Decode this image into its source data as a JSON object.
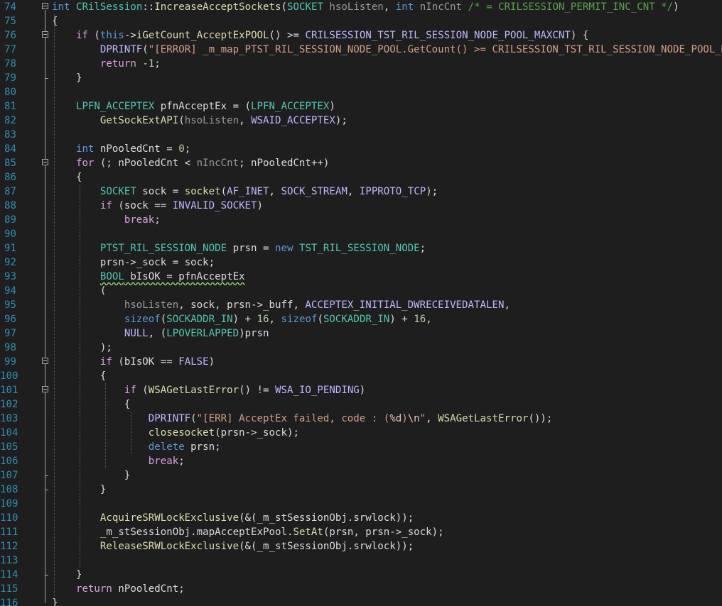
{
  "editor": {
    "colors": {
      "background": "#1e1e1e",
      "line_number": "#2b91af",
      "default": "#dcdcdc",
      "keyword": "#569cd6",
      "control": "#d8a0df",
      "type": "#4ec9b0",
      "function": "#dcdcaa",
      "string": "#d69d85",
      "number": "#b5cea8",
      "comment": "#57a64a",
      "macro": "#beb7ff",
      "param": "#9a9a9a",
      "member": "#dadada",
      "escape": "#e8c9bb"
    },
    "lines": [
      {
        "n": "74",
        "fold": true,
        "tokens": [
          [
            "keyword",
            "int"
          ],
          [
            "default",
            " "
          ],
          [
            "type",
            "CRilSession"
          ],
          [
            "default",
            "::"
          ],
          [
            "function",
            "IncreaseAcceptSockets"
          ],
          [
            "default",
            "("
          ],
          [
            "type",
            "SOCKET"
          ],
          [
            "default",
            " "
          ],
          [
            "param",
            "hsoListen"
          ],
          [
            "default",
            ", "
          ],
          [
            "keyword",
            "int"
          ],
          [
            "default",
            " "
          ],
          [
            "param",
            "nIncCnt"
          ],
          [
            "default",
            " "
          ],
          [
            "comment",
            "/* = CRILSESSION_PERMIT_INC_CNT */"
          ],
          [
            "default",
            ")"
          ]
        ]
      },
      {
        "n": "75",
        "fold": false,
        "tokens": [
          [
            "default",
            "{"
          ]
        ]
      },
      {
        "n": "76",
        "fold": true,
        "tokens": [
          [
            "default",
            "    "
          ],
          [
            "control",
            "if"
          ],
          [
            "default",
            " ("
          ],
          [
            "keyword",
            "this"
          ],
          [
            "default",
            "->"
          ],
          [
            "function",
            "iGetCount_AcceptExPOOL"
          ],
          [
            "default",
            "() >= "
          ],
          [
            "macro",
            "CRILSESSION_TST_RIL_SESSION_NODE_POOL_MAXCNT"
          ],
          [
            "default",
            ") {"
          ]
        ]
      },
      {
        "n": "77",
        "fold": false,
        "tokens": [
          [
            "default",
            "        "
          ],
          [
            "macro",
            "DPRINTF"
          ],
          [
            "default",
            "("
          ],
          [
            "string",
            "\"[ERROR] _m_map_PTST_RIL_SESSION_NODE_POOL.GetCount() >= CRILSESSION_TST_RIL_SESSION_NODE_POOL_MAXCNT\\n\""
          ],
          [
            "default",
            ");"
          ]
        ]
      },
      {
        "n": "78",
        "fold": false,
        "tokens": [
          [
            "default",
            "        "
          ],
          [
            "control",
            "return"
          ],
          [
            "default",
            " -"
          ],
          [
            "number",
            "1"
          ],
          [
            "default",
            ";"
          ]
        ]
      },
      {
        "n": "79",
        "fold": false,
        "tokens": [
          [
            "default",
            "    }"
          ]
        ]
      },
      {
        "n": "80",
        "fold": false,
        "tokens": []
      },
      {
        "n": "81",
        "fold": false,
        "tokens": [
          [
            "default",
            "    "
          ],
          [
            "type",
            "LPFN_ACCEPTEX"
          ],
          [
            "default",
            " "
          ],
          [
            "default",
            "pfnAcceptEx = ("
          ],
          [
            "type",
            "LPFN_ACCEPTEX"
          ],
          [
            "default",
            ")"
          ]
        ]
      },
      {
        "n": "82",
        "fold": false,
        "tokens": [
          [
            "default",
            "        "
          ],
          [
            "function",
            "GetSockExtAPI"
          ],
          [
            "default",
            "("
          ],
          [
            "param",
            "hsoListen"
          ],
          [
            "default",
            ", "
          ],
          [
            "macro",
            "WSAID_ACCEPTEX"
          ],
          [
            "default",
            ");"
          ]
        ]
      },
      {
        "n": "83",
        "fold": false,
        "tokens": []
      },
      {
        "n": "84",
        "fold": false,
        "tokens": [
          [
            "default",
            "    "
          ],
          [
            "keyword",
            "int"
          ],
          [
            "default",
            " nPooledCnt = "
          ],
          [
            "number",
            "0"
          ],
          [
            "default",
            ";"
          ]
        ]
      },
      {
        "n": "85",
        "fold": true,
        "tokens": [
          [
            "default",
            "    "
          ],
          [
            "control",
            "for"
          ],
          [
            "default",
            " (; nPooledCnt < "
          ],
          [
            "param",
            "nIncCnt"
          ],
          [
            "default",
            "; nPooledCnt++)"
          ]
        ]
      },
      {
        "n": "86",
        "fold": false,
        "tokens": [
          [
            "default",
            "    {"
          ]
        ]
      },
      {
        "n": "87",
        "fold": false,
        "tokens": [
          [
            "default",
            "        "
          ],
          [
            "type",
            "SOCKET"
          ],
          [
            "default",
            " sock = "
          ],
          [
            "function",
            "socket"
          ],
          [
            "default",
            "("
          ],
          [
            "macro",
            "AF_INET"
          ],
          [
            "default",
            ", "
          ],
          [
            "macro",
            "SOCK_STREAM"
          ],
          [
            "default",
            ", "
          ],
          [
            "macro",
            "IPPROTO_TCP"
          ],
          [
            "default",
            ");"
          ]
        ]
      },
      {
        "n": "88",
        "fold": false,
        "tokens": [
          [
            "default",
            "        "
          ],
          [
            "control",
            "if"
          ],
          [
            "default",
            " (sock == "
          ],
          [
            "macro",
            "INVALID_SOCKET"
          ],
          [
            "default",
            ")"
          ]
        ]
      },
      {
        "n": "89",
        "fold": false,
        "tokens": [
          [
            "default",
            "            "
          ],
          [
            "control",
            "break"
          ],
          [
            "default",
            ";"
          ]
        ]
      },
      {
        "n": "90",
        "fold": false,
        "tokens": []
      },
      {
        "n": "91",
        "fold": false,
        "tokens": [
          [
            "default",
            "        "
          ],
          [
            "type",
            "PTST_RIL_SESSION_NODE"
          ],
          [
            "default",
            " prsn = "
          ],
          [
            "keyword",
            "new"
          ],
          [
            "default",
            " "
          ],
          [
            "type",
            "TST_RIL_SESSION_NODE"
          ],
          [
            "default",
            ";"
          ]
        ]
      },
      {
        "n": "92",
        "fold": false,
        "tokens": [
          [
            "default",
            "        prsn->"
          ],
          [
            "member",
            "_sock"
          ],
          [
            "default",
            " = sock;"
          ]
        ]
      },
      {
        "n": "93",
        "fold": false,
        "tokens": [
          [
            "default",
            "        "
          ],
          [
            "type squig",
            "BOOL"
          ],
          [
            "default squig",
            " bIsOK = pfnAcceptEx"
          ]
        ]
      },
      {
        "n": "94",
        "fold": false,
        "tokens": [
          [
            "default",
            "        ("
          ]
        ]
      },
      {
        "n": "95",
        "fold": false,
        "tokens": [
          [
            "default",
            "            "
          ],
          [
            "param",
            "hsoListen"
          ],
          [
            "default",
            ", sock, prsn->"
          ],
          [
            "member",
            "_buff"
          ],
          [
            "default",
            ", "
          ],
          [
            "macro",
            "ACCEPTEX_INITIAL_DWRECEIVEDATALEN"
          ],
          [
            "default",
            ","
          ]
        ]
      },
      {
        "n": "96",
        "fold": false,
        "tokens": [
          [
            "default",
            "            "
          ],
          [
            "keyword",
            "sizeof"
          ],
          [
            "default",
            "("
          ],
          [
            "type",
            "SOCKADDR_IN"
          ],
          [
            "default",
            ") + "
          ],
          [
            "number",
            "16"
          ],
          [
            "default",
            ", "
          ],
          [
            "keyword",
            "sizeof"
          ],
          [
            "default",
            "("
          ],
          [
            "type",
            "SOCKADDR_IN"
          ],
          [
            "default",
            ") + "
          ],
          [
            "number",
            "16"
          ],
          [
            "default",
            ","
          ]
        ]
      },
      {
        "n": "97",
        "fold": false,
        "tokens": [
          [
            "default",
            "            "
          ],
          [
            "macro",
            "NULL"
          ],
          [
            "default",
            ", ("
          ],
          [
            "type",
            "LPOVERLAPPED"
          ],
          [
            "default",
            ")prsn"
          ]
        ]
      },
      {
        "n": "98",
        "fold": false,
        "tokens": [
          [
            "default",
            "        );"
          ]
        ]
      },
      {
        "n": "99",
        "fold": true,
        "tokens": [
          [
            "default",
            "        "
          ],
          [
            "control",
            "if"
          ],
          [
            "default",
            " (bIsOK == "
          ],
          [
            "macro",
            "FALSE"
          ],
          [
            "default",
            ")"
          ]
        ]
      },
      {
        "n": "100",
        "fold": false,
        "tokens": [
          [
            "default",
            "        {"
          ]
        ]
      },
      {
        "n": "101",
        "fold": true,
        "tokens": [
          [
            "default",
            "            "
          ],
          [
            "control",
            "if"
          ],
          [
            "default",
            " ("
          ],
          [
            "function",
            "WSAGetLastError"
          ],
          [
            "default",
            "() != "
          ],
          [
            "macro",
            "WSA_IO_PENDING"
          ],
          [
            "default",
            ")"
          ]
        ]
      },
      {
        "n": "102",
        "fold": false,
        "tokens": [
          [
            "default",
            "            {"
          ]
        ]
      },
      {
        "n": "103",
        "fold": false,
        "tokens": [
          [
            "default",
            "                "
          ],
          [
            "macro",
            "DPRINTF"
          ],
          [
            "default",
            "("
          ],
          [
            "string",
            "\"[ERR] AcceptEx failed, code : ("
          ],
          [
            "escape",
            "%d"
          ],
          [
            "string",
            ")"
          ],
          [
            "escape",
            "\\n"
          ],
          [
            "string",
            "\""
          ],
          [
            "default",
            ", "
          ],
          [
            "function",
            "WSAGetLastError"
          ],
          [
            "default",
            "());"
          ]
        ]
      },
      {
        "n": "104",
        "fold": false,
        "tokens": [
          [
            "default",
            "                "
          ],
          [
            "function",
            "closesocket"
          ],
          [
            "default",
            "(prsn->"
          ],
          [
            "member",
            "_sock"
          ],
          [
            "default",
            ");"
          ]
        ]
      },
      {
        "n": "105",
        "fold": false,
        "tokens": [
          [
            "default",
            "                "
          ],
          [
            "keyword",
            "delete"
          ],
          [
            "default",
            " prsn;"
          ]
        ]
      },
      {
        "n": "106",
        "fold": false,
        "tokens": [
          [
            "default",
            "                "
          ],
          [
            "control",
            "break"
          ],
          [
            "default",
            ";"
          ]
        ]
      },
      {
        "n": "107",
        "fold": false,
        "tokens": [
          [
            "default",
            "            }"
          ]
        ]
      },
      {
        "n": "108",
        "fold": false,
        "tokens": [
          [
            "default",
            "        }"
          ]
        ]
      },
      {
        "n": "109",
        "fold": false,
        "tokens": []
      },
      {
        "n": "110",
        "fold": false,
        "tokens": [
          [
            "default",
            "        "
          ],
          [
            "function",
            "AcquireSRWLockExclusive"
          ],
          [
            "default",
            "(&("
          ],
          [
            "member",
            "_m_stSessionObj"
          ],
          [
            "default",
            "."
          ],
          [
            "member",
            "srwlock"
          ],
          [
            "default",
            "));"
          ]
        ]
      },
      {
        "n": "111",
        "fold": false,
        "tokens": [
          [
            "default",
            "        "
          ],
          [
            "member",
            "_m_stSessionObj"
          ],
          [
            "default",
            "."
          ],
          [
            "member",
            "mapAcceptExPool"
          ],
          [
            "default",
            "."
          ],
          [
            "function",
            "SetAt"
          ],
          [
            "default",
            "(prsn, prsn->"
          ],
          [
            "member",
            "_sock"
          ],
          [
            "default",
            ");"
          ]
        ]
      },
      {
        "n": "112",
        "fold": false,
        "tokens": [
          [
            "default",
            "        "
          ],
          [
            "function",
            "ReleaseSRWLockExclusive"
          ],
          [
            "default",
            "(&("
          ],
          [
            "member",
            "_m_stSessionObj"
          ],
          [
            "default",
            "."
          ],
          [
            "member",
            "srwlock"
          ],
          [
            "default",
            "));"
          ]
        ]
      },
      {
        "n": "113",
        "fold": false,
        "tokens": []
      },
      {
        "n": "114",
        "fold": false,
        "tokens": [
          [
            "default",
            "    }"
          ]
        ]
      },
      {
        "n": "115",
        "fold": false,
        "tokens": [
          [
            "default",
            "    "
          ],
          [
            "control",
            "return"
          ],
          [
            "default",
            " nPooledCnt;"
          ]
        ]
      },
      {
        "n": "116",
        "fold": false,
        "tokens": [
          [
            "default",
            "}"
          ]
        ]
      }
    ]
  }
}
